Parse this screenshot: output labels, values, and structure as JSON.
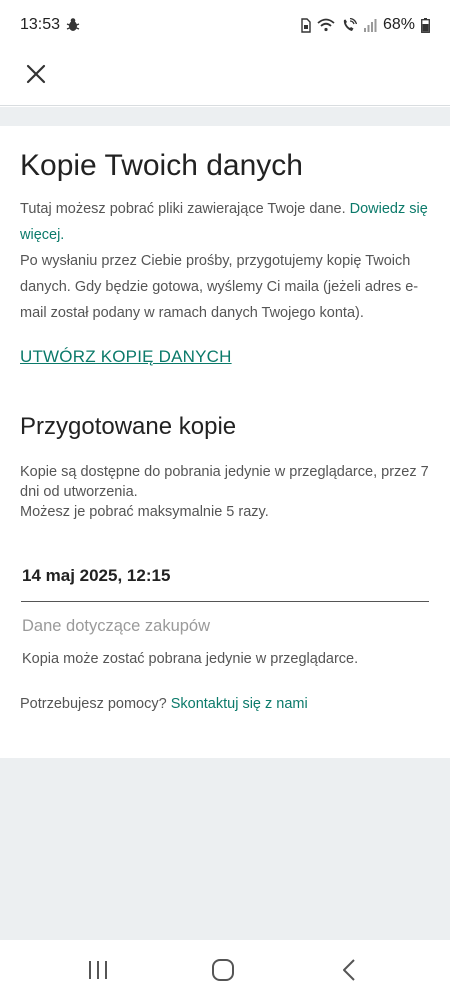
{
  "status_bar": {
    "time": "13:53",
    "battery": "68%",
    "icons": [
      "bug-icon",
      "sim-icon",
      "wifi-icon",
      "wifi-call-icon",
      "signal-icon",
      "battery-icon"
    ]
  },
  "app_bar": {
    "close_icon": "close-icon"
  },
  "main": {
    "title": "Kopie Twoich danych",
    "intro_text_1": "Tutaj możesz pobrać pliki zawierające Twoje dane. ",
    "intro_link": "Dowiedz się więcej.",
    "intro_text_2": "Po wysłaniu przez Ciebie prośby, przygotujemy kopię Twoich danych. Gdy będzie gotowa, wyślemy Ci maila (jeżeli adres e-mail został podany w ramach danych Twojego konta).",
    "create_copy_link": "UTWÓRZ KOPIĘ DANYCH",
    "prepared_title": "Przygotowane kopie",
    "prepared_desc_1": "Kopie są dostępne do pobrania jedynie w przeglądarce, przez 7 dni od utworzenia.",
    "prepared_desc_2": "Możesz je pobrać maksymalnie 5 razy.",
    "copy": {
      "date": "14 maj 2025, 12:15",
      "type": "Dane dotyczące zakupów",
      "note": "Kopia może zostać pobrana jedynie w przeglądarce."
    },
    "help_text": "Potrzebujesz pomocy? ",
    "help_link": "Skontaktuj się z nami"
  },
  "colors": {
    "accent": "#0b7a6a",
    "band": "#eceff1"
  },
  "nav_bar": {
    "icons": [
      "recent-apps-icon",
      "home-icon",
      "back-icon"
    ]
  }
}
